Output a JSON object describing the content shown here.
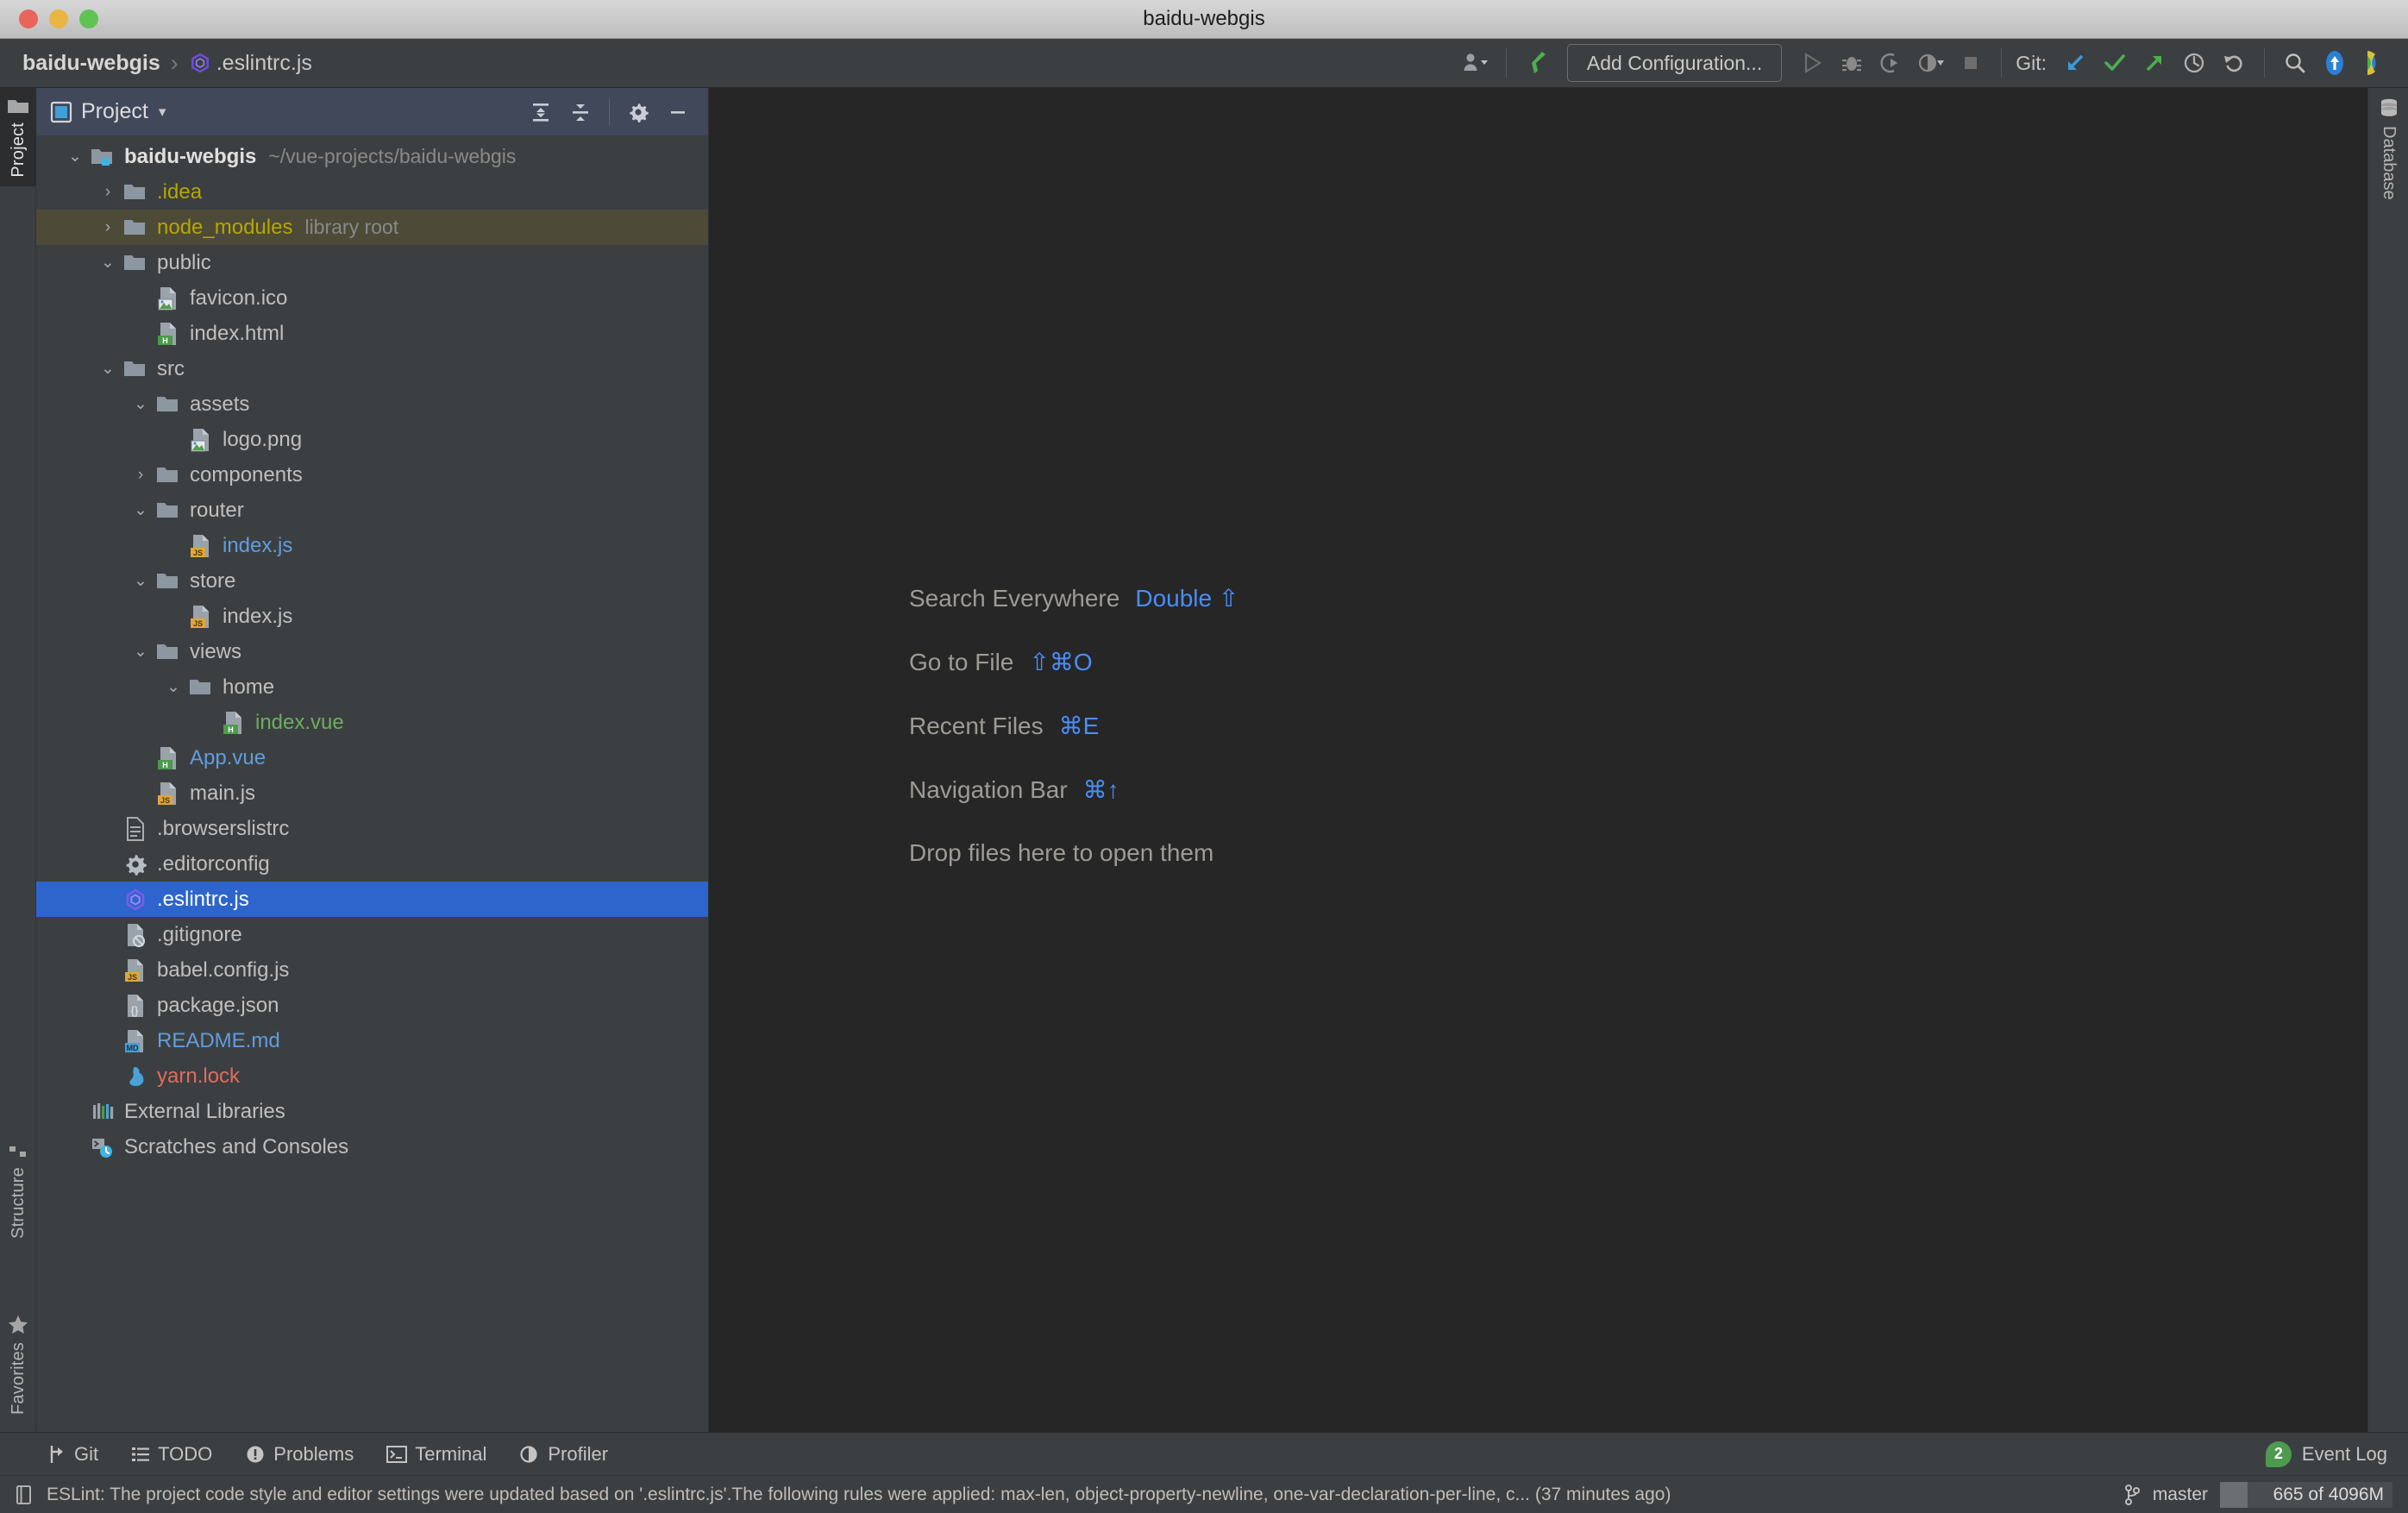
{
  "window": {
    "title": "baidu-webgis"
  },
  "navbar": {
    "breadcrumb_project": "baidu-webgis",
    "breadcrumb_separator": "›",
    "breadcrumb_file": ".eslintrc.js",
    "run_config_label": "Add Configuration...",
    "git_label": "Git:",
    "icons": {
      "user": "user-dropdown-icon",
      "build": "build-hammer-icon",
      "run": "run-icon",
      "debug": "debug-icon",
      "run_coverage": "run-with-coverage-icon",
      "profile": "profile-icon",
      "stop": "stop-icon",
      "git_update": "git-update-project-icon",
      "git_commit": "git-commit-icon",
      "git_push": "git-push-icon",
      "git_history": "git-history-icon",
      "git_rollback": "git-rollback-icon",
      "search": "search-everywhere-icon",
      "updates": "ide-update-icon",
      "feedback": "feedback-icon"
    }
  },
  "left_tool_strip": [
    {
      "label": "Project",
      "icon": "project-icon",
      "active": true
    },
    {
      "label": "Structure",
      "icon": "structure-icon",
      "active": false
    },
    {
      "label": "Favorites",
      "icon": "star-icon",
      "active": false
    }
  ],
  "right_tool_strip": [
    {
      "label": "Database",
      "icon": "database-icon",
      "active": false
    }
  ],
  "project_panel": {
    "title": "Project",
    "caret": "▾",
    "actions": [
      {
        "name": "expand-all-button",
        "icon": "expand-all-icon"
      },
      {
        "name": "collapse-all-button",
        "icon": "collapse-all-icon"
      },
      {
        "name": "settings-button",
        "icon": "gear-icon"
      },
      {
        "name": "hide-button",
        "icon": "minimize-icon"
      }
    ],
    "tree": [
      {
        "label": "baidu-webgis",
        "sub": "~/vue-projects/baidu-webgis",
        "arrow": "⌄",
        "icon": "module-folder-icon",
        "indent": 0,
        "style": "bold"
      },
      {
        "label": ".idea",
        "sub": "",
        "arrow": "›",
        "icon": "folder-icon",
        "indent": 1,
        "style": "yellow"
      },
      {
        "label": "node_modules",
        "sub": "library root",
        "arrow": "›",
        "icon": "folder-icon",
        "indent": 1,
        "style": "yellow",
        "highlight": "library"
      },
      {
        "label": "public",
        "sub": "",
        "arrow": "⌄",
        "icon": "folder-icon",
        "indent": 1,
        "style": "grey"
      },
      {
        "label": "favicon.ico",
        "sub": "",
        "arrow": "",
        "icon": "image-file-icon",
        "indent": 2,
        "style": "grey"
      },
      {
        "label": "index.html",
        "sub": "",
        "arrow": "",
        "icon": "html-file-icon",
        "indent": 2,
        "style": "grey"
      },
      {
        "label": "src",
        "sub": "",
        "arrow": "⌄",
        "icon": "folder-icon",
        "indent": 1,
        "style": "grey"
      },
      {
        "label": "assets",
        "sub": "",
        "arrow": "⌄",
        "icon": "folder-icon",
        "indent": 2,
        "style": "grey"
      },
      {
        "label": "logo.png",
        "sub": "",
        "arrow": "",
        "icon": "image-file-icon",
        "indent": 3,
        "style": "grey"
      },
      {
        "label": "components",
        "sub": "",
        "arrow": "›",
        "icon": "folder-icon",
        "indent": 2,
        "style": "grey"
      },
      {
        "label": "router",
        "sub": "",
        "arrow": "⌄",
        "icon": "folder-icon",
        "indent": 2,
        "style": "grey"
      },
      {
        "label": "index.js",
        "sub": "",
        "arrow": "",
        "icon": "js-file-icon",
        "indent": 3,
        "style": "blue"
      },
      {
        "label": "store",
        "sub": "",
        "arrow": "⌄",
        "icon": "folder-icon",
        "indent": 2,
        "style": "grey"
      },
      {
        "label": "index.js",
        "sub": "",
        "arrow": "",
        "icon": "js-file-icon",
        "indent": 3,
        "style": "grey"
      },
      {
        "label": "views",
        "sub": "",
        "arrow": "⌄",
        "icon": "folder-icon",
        "indent": 2,
        "style": "grey"
      },
      {
        "label": "home",
        "sub": "",
        "arrow": "⌄",
        "icon": "folder-icon",
        "indent": 3,
        "style": "grey"
      },
      {
        "label": "index.vue",
        "sub": "",
        "arrow": "",
        "icon": "vue-file-icon",
        "indent": 4,
        "style": "green"
      },
      {
        "label": "App.vue",
        "sub": "",
        "arrow": "",
        "icon": "vue-file-icon",
        "indent": 2,
        "style": "blue"
      },
      {
        "label": "main.js",
        "sub": "",
        "arrow": "",
        "icon": "js-file-icon",
        "indent": 2,
        "style": "grey"
      },
      {
        "label": ".browserslistrc",
        "sub": "",
        "arrow": "",
        "icon": "text-file-icon",
        "indent": 1,
        "style": "grey"
      },
      {
        "label": ".editorconfig",
        "sub": "",
        "arrow": "",
        "icon": "config-file-icon",
        "indent": 1,
        "style": "grey"
      },
      {
        "label": ".eslintrc.js",
        "sub": "",
        "arrow": "",
        "icon": "eslint-file-icon",
        "indent": 1,
        "style": "white",
        "selected": true
      },
      {
        "label": ".gitignore",
        "sub": "",
        "arrow": "",
        "icon": "gitignore-file-icon",
        "indent": 1,
        "style": "grey"
      },
      {
        "label": "babel.config.js",
        "sub": "",
        "arrow": "",
        "icon": "js-file-icon",
        "indent": 1,
        "style": "grey"
      },
      {
        "label": "package.json",
        "sub": "",
        "arrow": "",
        "icon": "json-file-icon",
        "indent": 1,
        "style": "grey"
      },
      {
        "label": "README.md",
        "sub": "",
        "arrow": "",
        "icon": "markdown-file-icon",
        "indent": 1,
        "style": "blue"
      },
      {
        "label": "yarn.lock",
        "sub": "",
        "arrow": "",
        "icon": "yarn-file-icon",
        "indent": 1,
        "style": "red"
      },
      {
        "label": "External Libraries",
        "sub": "",
        "arrow": "",
        "icon": "libraries-icon",
        "indent": 0,
        "style": "grey"
      },
      {
        "label": "Scratches and Consoles",
        "sub": "",
        "arrow": "",
        "icon": "scratches-icon",
        "indent": 0,
        "style": "grey"
      }
    ]
  },
  "editor": {
    "hints": [
      {
        "name": "Search Everywhere",
        "keys": "Double ⇧"
      },
      {
        "name": "Go to File",
        "keys": "⇧⌘O"
      },
      {
        "name": "Recent Files",
        "keys": "⌘E"
      },
      {
        "name": "Navigation Bar",
        "keys": "⌘↑"
      }
    ],
    "drop_hint": "Drop files here to open them"
  },
  "bottom_tool_window_bar": {
    "buttons": [
      {
        "label": "Git",
        "icon": "git-branch-icon"
      },
      {
        "label": "TODO",
        "icon": "todo-list-icon"
      },
      {
        "label": "Problems",
        "icon": "problems-icon"
      },
      {
        "label": "Terminal",
        "icon": "terminal-icon"
      },
      {
        "label": "Profiler",
        "icon": "profiler-icon"
      }
    ],
    "event_log": {
      "label": "Event Log",
      "count": "2"
    }
  },
  "status_bar": {
    "message": "ESLint: The project code style and editor settings were updated based on '.eslintrc.js'.The following rules were applied: max-len, object-property-newline, one-var-declaration-per-line, c... (37 minutes ago)",
    "branch": "master",
    "memory": "665 of 4096M",
    "memory_percent": 16
  },
  "colors": {
    "selection_blue": "#2d65cc",
    "library_root_highlight": "#4e4a38",
    "editor_bg": "#262626",
    "panel_bg": "#3c3f41",
    "panel_header_bg": "#41485a",
    "accent_link": "#4a8df8",
    "git_modified": "#5f9ddd",
    "git_added": "#6caf5f",
    "git_ignored": "#e06c5e",
    "folder_excluded": "#b5a700",
    "badge_green": "#4e9a4e"
  }
}
